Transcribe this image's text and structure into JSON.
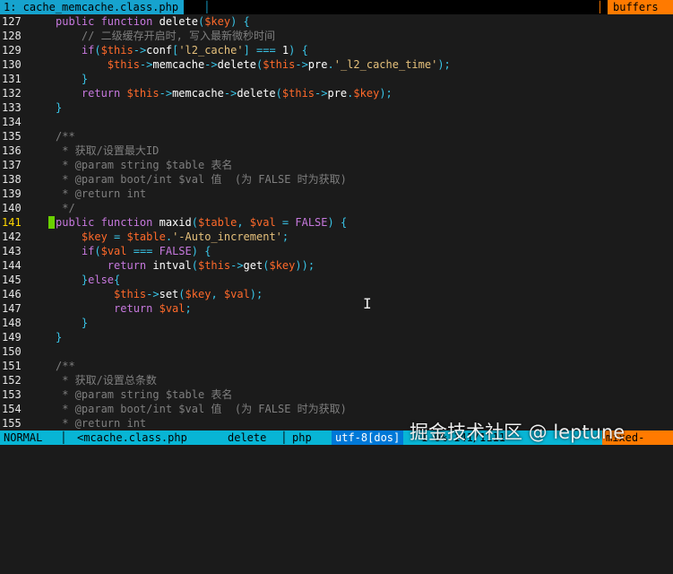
{
  "tabline": {
    "active_tab": "1: cache_memcache.class.php",
    "buffers_label": "buffers"
  },
  "editor": {
    "lines": [
      {
        "n": "127",
        "segs": [
          [
            "kw",
            "public "
          ],
          [
            "kw",
            "function "
          ],
          [
            "fn",
            "delete"
          ],
          [
            "op",
            "("
          ],
          [
            "var",
            "$key"
          ],
          [
            "op",
            ") {"
          ]
        ]
      },
      {
        "n": "128",
        "segs": [
          [
            "cm",
            "    // 二级缓存开启时, 写入最新微秒时间"
          ]
        ]
      },
      {
        "n": "129",
        "segs": [
          [
            "kw",
            "    if"
          ],
          [
            "op",
            "("
          ],
          [
            "var",
            "$this"
          ],
          [
            "op",
            "->"
          ],
          [
            "fn",
            "conf"
          ],
          [
            "op",
            "["
          ],
          [
            "str",
            "'l2_cache'"
          ],
          [
            "op",
            "] === "
          ],
          [
            "fn",
            "1"
          ],
          [
            "op",
            ") {"
          ]
        ]
      },
      {
        "n": "130",
        "segs": [
          [
            "var",
            "        $this"
          ],
          [
            "op",
            "->"
          ],
          [
            "fn",
            "memcache"
          ],
          [
            "op",
            "->"
          ],
          [
            "fn",
            "delete"
          ],
          [
            "op",
            "("
          ],
          [
            "var",
            "$this"
          ],
          [
            "op",
            "->"
          ],
          [
            "fn",
            "pre"
          ],
          [
            "op",
            "."
          ],
          [
            "str",
            "'_l2_cache_time'"
          ],
          [
            "op",
            ");"
          ]
        ]
      },
      {
        "n": "131",
        "segs": [
          [
            "op",
            "    }"
          ]
        ]
      },
      {
        "n": "132",
        "segs": [
          [
            "kw",
            "    return "
          ],
          [
            "var",
            "$this"
          ],
          [
            "op",
            "->"
          ],
          [
            "fn",
            "memcache"
          ],
          [
            "op",
            "->"
          ],
          [
            "fn",
            "delete"
          ],
          [
            "op",
            "("
          ],
          [
            "var",
            "$this"
          ],
          [
            "op",
            "->"
          ],
          [
            "fn",
            "pre"
          ],
          [
            "op",
            "."
          ],
          [
            "var",
            "$key"
          ],
          [
            "op",
            ");"
          ]
        ]
      },
      {
        "n": "133",
        "segs": [
          [
            "op",
            "}"
          ]
        ]
      },
      {
        "n": "134",
        "segs": []
      },
      {
        "n": "135",
        "segs": [
          [
            "cm",
            "/**"
          ]
        ]
      },
      {
        "n": "136",
        "segs": [
          [
            "cm",
            " * 获取/设置最大ID"
          ]
        ]
      },
      {
        "n": "137",
        "segs": [
          [
            "cm",
            " * @param string $table 表名"
          ]
        ]
      },
      {
        "n": "138",
        "segs": [
          [
            "cm",
            " * @param boot/int $val 值  (为 FALSE 时为获取)"
          ]
        ]
      },
      {
        "n": "139",
        "segs": [
          [
            "cm",
            " * @return int"
          ]
        ]
      },
      {
        "n": "140",
        "segs": [
          [
            "cm",
            " */"
          ]
        ]
      },
      {
        "n": "141",
        "cur": true,
        "segs": [
          [
            "kw",
            "public "
          ],
          [
            "kw",
            "function "
          ],
          [
            "fn",
            "maxid"
          ],
          [
            "op",
            "("
          ],
          [
            "var",
            "$table"
          ],
          [
            "op",
            ", "
          ],
          [
            "var",
            "$val"
          ],
          [
            "op",
            " = "
          ],
          [
            "const",
            "FALSE"
          ],
          [
            "op",
            ") {"
          ]
        ]
      },
      {
        "n": "142",
        "segs": [
          [
            "var",
            "    $key"
          ],
          [
            "op",
            " = "
          ],
          [
            "var",
            "$table"
          ],
          [
            "op",
            "."
          ],
          [
            "str",
            "'-Auto_increment'"
          ],
          [
            "op",
            ";"
          ]
        ]
      },
      {
        "n": "143",
        "segs": [
          [
            "kw",
            "    if"
          ],
          [
            "op",
            "("
          ],
          [
            "var",
            "$val"
          ],
          [
            "op",
            " === "
          ],
          [
            "const",
            "FALSE"
          ],
          [
            "op",
            ") {"
          ]
        ]
      },
      {
        "n": "144",
        "segs": [
          [
            "kw",
            "        return "
          ],
          [
            "fn",
            "intval"
          ],
          [
            "op",
            "("
          ],
          [
            "var",
            "$this"
          ],
          [
            "op",
            "->"
          ],
          [
            "fn",
            "get"
          ],
          [
            "op",
            "("
          ],
          [
            "var",
            "$key"
          ],
          [
            "op",
            "));"
          ]
        ]
      },
      {
        "n": "145",
        "segs": [
          [
            "op",
            "    }"
          ],
          [
            "kw",
            "else"
          ],
          [
            "op",
            "{"
          ]
        ]
      },
      {
        "n": "146",
        "segs": [
          [
            "var",
            "         $this"
          ],
          [
            "op",
            "->"
          ],
          [
            "fn",
            "set"
          ],
          [
            "op",
            "("
          ],
          [
            "var",
            "$key"
          ],
          [
            "op",
            ", "
          ],
          [
            "var",
            "$val"
          ],
          [
            "op",
            ");"
          ]
        ]
      },
      {
        "n": "147",
        "segs": [
          [
            "kw",
            "         return "
          ],
          [
            "var",
            "$val"
          ],
          [
            "op",
            ";"
          ]
        ]
      },
      {
        "n": "148",
        "segs": [
          [
            "op",
            "    }"
          ]
        ]
      },
      {
        "n": "149",
        "segs": [
          [
            "op",
            "}"
          ]
        ]
      },
      {
        "n": "150",
        "segs": []
      },
      {
        "n": "151",
        "segs": [
          [
            "cm",
            "/**"
          ]
        ]
      },
      {
        "n": "152",
        "segs": [
          [
            "cm",
            " * 获取/设置总条数"
          ]
        ]
      },
      {
        "n": "153",
        "segs": [
          [
            "cm",
            " * @param string $table 表名"
          ]
        ]
      },
      {
        "n": "154",
        "segs": [
          [
            "cm",
            " * @param boot/int $val 值  (为 FALSE 时为获取)"
          ]
        ]
      },
      {
        "n": "155",
        "segs": [
          [
            "cm",
            " * @return int"
          ]
        ]
      }
    ]
  },
  "statusline": {
    "mode": "NORMAL",
    "file": "<mcache.class.php",
    "function": "delete",
    "filetype": "php",
    "encoding": "utf-8[dos]",
    "position": "1 0% 141/1111 ",
    "warnings": "mixed-"
  },
  "watermark": "掘金技术社区 @ leptune",
  "colors": {
    "tab_active": "#16a3ce",
    "tab_buffers": "#ff7a00",
    "status_bg": "#08b5d5",
    "sign_column": "#6ad000",
    "background": "#1b1b1b"
  }
}
